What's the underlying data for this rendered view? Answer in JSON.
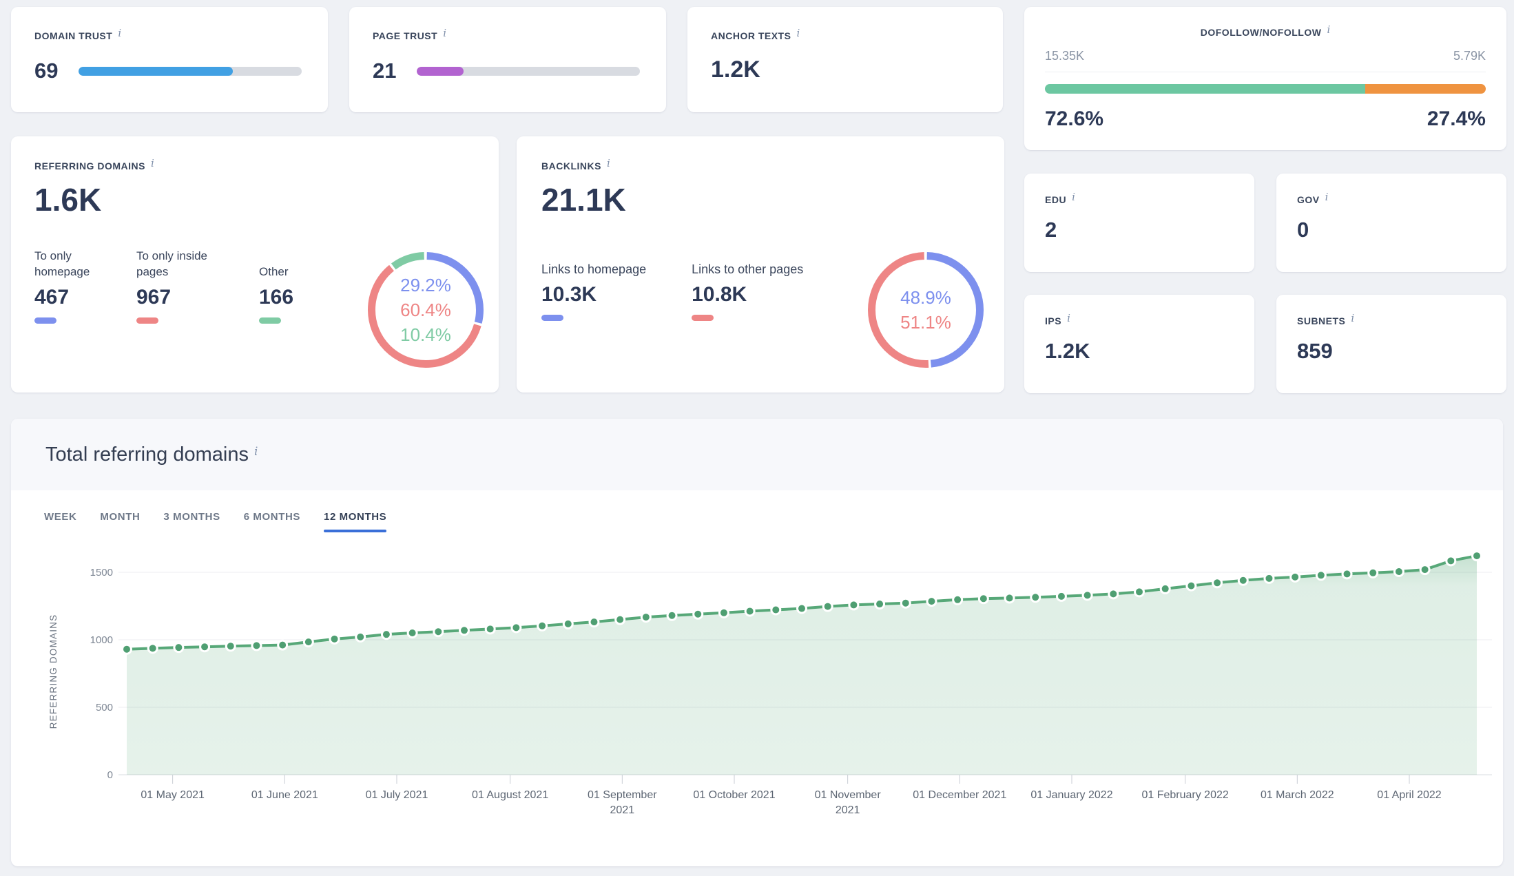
{
  "icons": {
    "info": "i"
  },
  "cards": {
    "domain_trust": {
      "title": "DOMAIN TRUST",
      "value": "69",
      "percent": 69,
      "bar_color": "#41a0e3"
    },
    "page_trust": {
      "title": "PAGE TRUST",
      "value": "21",
      "percent": 21,
      "bar_color": "#b263d0"
    },
    "anchor_texts": {
      "title": "ANCHOR TEXTS",
      "value": "1.2K"
    },
    "dofollow": {
      "title": "DOFOLLOW/NOFOLLOW",
      "left_count": "15.35K",
      "right_count": "5.79K",
      "left_pct_label": "72.6%",
      "right_pct_label": "27.4%",
      "left_percent": 72.6,
      "left_color": "#6cc7a1",
      "right_color": "#ef9340"
    },
    "referring_domains": {
      "title": "REFERRING DOMAINS",
      "value": "1.6K",
      "stats": [
        {
          "label": "To only homepage",
          "value": "467",
          "color": "#7d90ee"
        },
        {
          "label": "To only inside pages",
          "value": "967",
          "color": "#ee8585"
        },
        {
          "label": "Other",
          "value": "166",
          "color": "#7fcba4"
        }
      ],
      "donut": {
        "size": 168,
        "stroke": 11,
        "segments": [
          {
            "pct": 29.2,
            "color": "#7d90ee"
          },
          {
            "pct": 60.4,
            "color": "#ee8585"
          },
          {
            "pct": 10.4,
            "color": "#7fcba4"
          }
        ],
        "labels": [
          {
            "text": "29.2%",
            "color": "#7d90ee"
          },
          {
            "text": "60.4%",
            "color": "#ee8585"
          },
          {
            "text": "10.4%",
            "color": "#7fcba4"
          }
        ]
      }
    },
    "backlinks": {
      "title": "BACKLINKS",
      "value": "21.1K",
      "stats": [
        {
          "label": "Links to homepage",
          "value": "10.3K",
          "color": "#7d90ee"
        },
        {
          "label": "Links to other pages",
          "value": "10.8K",
          "color": "#ee8585"
        }
      ],
      "donut": {
        "size": 168,
        "stroke": 11,
        "segments": [
          {
            "pct": 48.9,
            "color": "#7d90ee"
          },
          {
            "pct": 51.1,
            "color": "#ee8585"
          }
        ],
        "labels": [
          {
            "text": "48.9%",
            "color": "#7d90ee"
          },
          {
            "text": "51.1%",
            "color": "#ee8585"
          }
        ]
      }
    },
    "edu": {
      "title": "EDU",
      "value": "2"
    },
    "gov": {
      "title": "GOV",
      "value": "0"
    },
    "ips": {
      "title": "IPS",
      "value": "1.2K"
    },
    "subnets": {
      "title": "SUBNETS",
      "value": "859"
    }
  },
  "section": {
    "title": "Total referring domains",
    "tabs": [
      {
        "label": "WEEK",
        "active": false
      },
      {
        "label": "MONTH",
        "active": false
      },
      {
        "label": "3 MONTHS",
        "active": false
      },
      {
        "label": "6 MONTHS",
        "active": false
      },
      {
        "label": "12 MONTHS",
        "active": true
      }
    ]
  },
  "chart_data": {
    "type": "area",
    "title": "Total referring domains",
    "ylabel": "REFERRING DOMAINS",
    "xlabel": "",
    "ylim": [
      0,
      1660
    ],
    "y_ticks": [
      0,
      500,
      1000,
      1500
    ],
    "grid": true,
    "legend": "none",
    "line_color": "#57a878",
    "dot_color": "#4f9f72",
    "fill_color": "#57a878",
    "x_unit": "week",
    "values": [
      930,
      937,
      943,
      948,
      953,
      957,
      961,
      984,
      1006,
      1021,
      1040,
      1051,
      1060,
      1070,
      1080,
      1090,
      1103,
      1118,
      1132,
      1150,
      1168,
      1180,
      1190,
      1200,
      1212,
      1222,
      1232,
      1247,
      1258,
      1265,
      1272,
      1285,
      1297,
      1305,
      1309,
      1315,
      1322,
      1330,
      1340,
      1355,
      1378,
      1400,
      1422,
      1440,
      1455,
      1465,
      1478,
      1488,
      1496,
      1505,
      1520,
      1585,
      1622
    ],
    "x_ticks": [
      {
        "frac": 0.034,
        "label": "01 May 2021"
      },
      {
        "frac": 0.117,
        "label": "01 June 2021"
      },
      {
        "frac": 0.2,
        "label": "01 July 2021"
      },
      {
        "frac": 0.284,
        "label": "01 August 2021"
      },
      {
        "frac": 0.367,
        "label": "01 September\n2021"
      },
      {
        "frac": 0.45,
        "label": "01 October 2021"
      },
      {
        "frac": 0.534,
        "label": "01 November\n2021"
      },
      {
        "frac": 0.617,
        "label": "01 December 2021"
      },
      {
        "frac": 0.7,
        "label": "01 January 2022"
      },
      {
        "frac": 0.784,
        "label": "01 February 2022"
      },
      {
        "frac": 0.867,
        "label": "01 March 2022"
      },
      {
        "frac": 0.95,
        "label": "01 April 2022"
      }
    ]
  }
}
